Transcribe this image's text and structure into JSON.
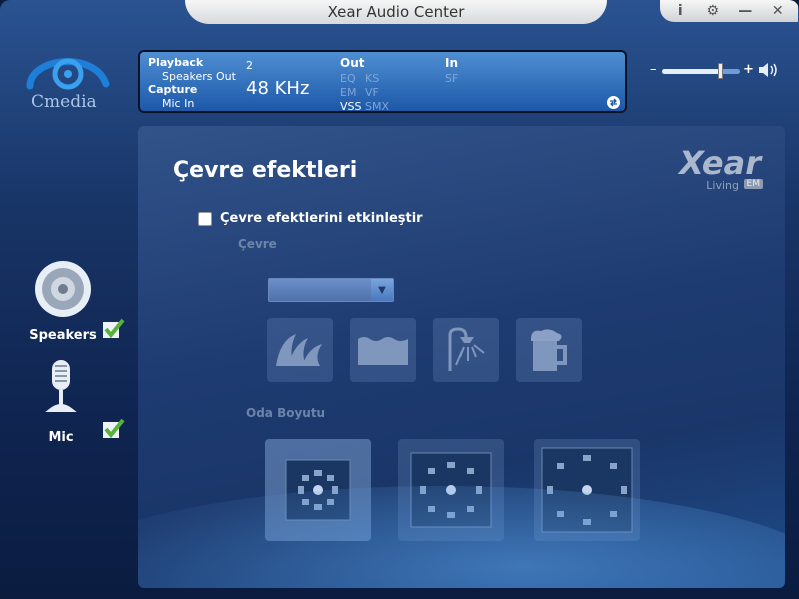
{
  "window": {
    "title": "Xear Audio Center",
    "controls": [
      "i",
      "⚙",
      "—",
      "✕"
    ]
  },
  "brand": {
    "logo_text": "Cmedia"
  },
  "status": {
    "playback_label": "Playback",
    "playback_device": "Speakers Out",
    "capture_label": "Capture",
    "capture_device": "Mic In",
    "channels": "2",
    "sample_rate": "48 KHz",
    "out_label": "Out",
    "out_items": [
      "EQ",
      "KS",
      "EM",
      "VF",
      "VSS",
      "SMX"
    ],
    "in_label": "In",
    "in_items": [
      "SF"
    ]
  },
  "volume": {
    "minus": "–",
    "plus": "+",
    "level": 0.75
  },
  "sidebar": {
    "items": [
      {
        "label": "Speakers",
        "enabled": true
      },
      {
        "label": "Mic",
        "enabled": true
      }
    ]
  },
  "panel": {
    "title": "Çevre efektleri",
    "xear_logo": "Xear",
    "xear_sub": "Living",
    "xear_badge": "EM",
    "enable_checkbox": {
      "label": "Çevre efektlerini etkinleştir",
      "checked": false
    },
    "environment_label": "Çevre",
    "environment_icons": [
      "opera-house-icon",
      "water-icon",
      "shower-icon",
      "beer-mug-icon"
    ],
    "room_size_label": "Oda Boyutu",
    "room_sizes": [
      "small-room-icon",
      "medium-room-icon",
      "large-room-icon"
    ]
  },
  "colors": {
    "accent": "#2e6ec0",
    "background": "#183466"
  }
}
